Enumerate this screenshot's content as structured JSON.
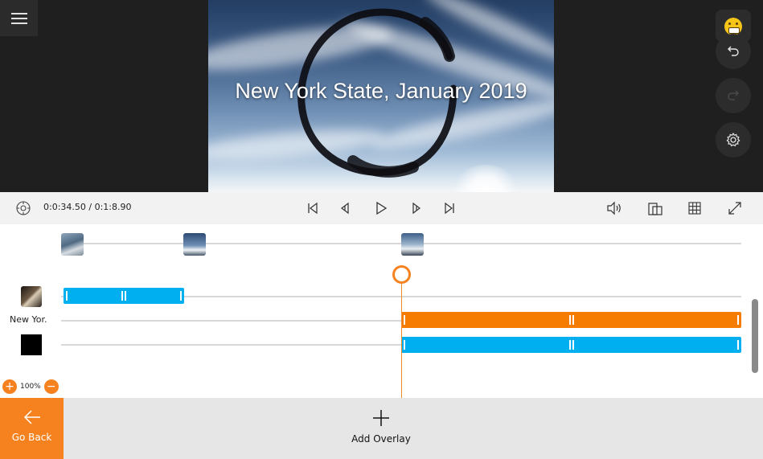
{
  "preview": {
    "title_text": "New York State, January 2019",
    "icons": [
      "menu-icon",
      "emoji-icon",
      "undo-icon",
      "redo-icon",
      "settings-icon"
    ]
  },
  "transport": {
    "time_readout": "0:0:34.50 / 0:1:8.90",
    "icons": [
      "playback-settings-icon",
      "skip-to-start-icon",
      "step-back-icon",
      "play-icon",
      "step-forward-icon",
      "skip-to-end-icon",
      "volume-icon",
      "aspect-ratio-icon",
      "grid-icon",
      "fullscreen-icon"
    ]
  },
  "timeline": {
    "overlay_track_label": "New Yor.",
    "zoom_level": "100%",
    "zoom_in_symbol": "+",
    "zoom_out_symbol": "−"
  },
  "bottom_bar": {
    "go_back_label": "Go Back",
    "add_overlay_label": "Add Overlay"
  },
  "colors": {
    "accent_orange": "#f5821f",
    "clip_blue": "#00aff0",
    "clip_orange": "#f57c00"
  }
}
